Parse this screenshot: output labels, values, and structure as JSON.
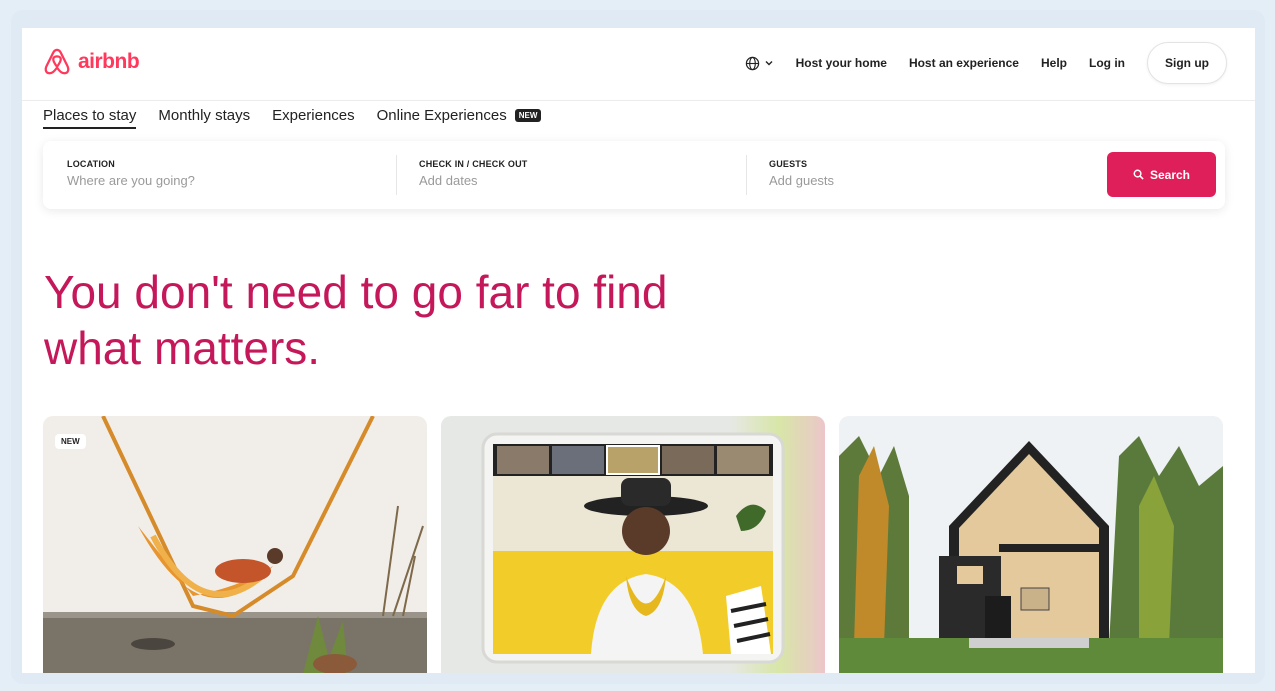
{
  "brand": {
    "name": "airbnb",
    "color": "#ff385c",
    "logo_icon": "airbnb-belo-icon"
  },
  "header": {
    "language_icon": "globe-icon",
    "nav": [
      "Host your home",
      "Host an experience",
      "Help",
      "Log in"
    ],
    "signup_label": "Sign up"
  },
  "tabs": [
    {
      "label": "Places to stay",
      "active": true
    },
    {
      "label": "Monthly stays",
      "active": false
    },
    {
      "label": "Experiences",
      "active": false
    },
    {
      "label": "Online Experiences",
      "active": false,
      "badge": "NEW"
    }
  ],
  "search": {
    "location": {
      "label": "LOCATION",
      "placeholder": "Where are you going?"
    },
    "dates": {
      "label": "CHECK IN / CHECK OUT",
      "placeholder": "Add dates"
    },
    "guests": {
      "label": "GUESTS",
      "placeholder": "Add guests"
    },
    "button_label": "Search",
    "button_color": "#df1f5a"
  },
  "hero": {
    "line1": "You don't need to go far to find",
    "line2": "what matters.",
    "color": "#c5185b"
  },
  "cards": [
    {
      "badge": "NEW",
      "image": "hammock-photo"
    },
    {
      "image": "online-experience-video-call-photo"
    },
    {
      "image": "cabin-in-forest-photo"
    }
  ]
}
